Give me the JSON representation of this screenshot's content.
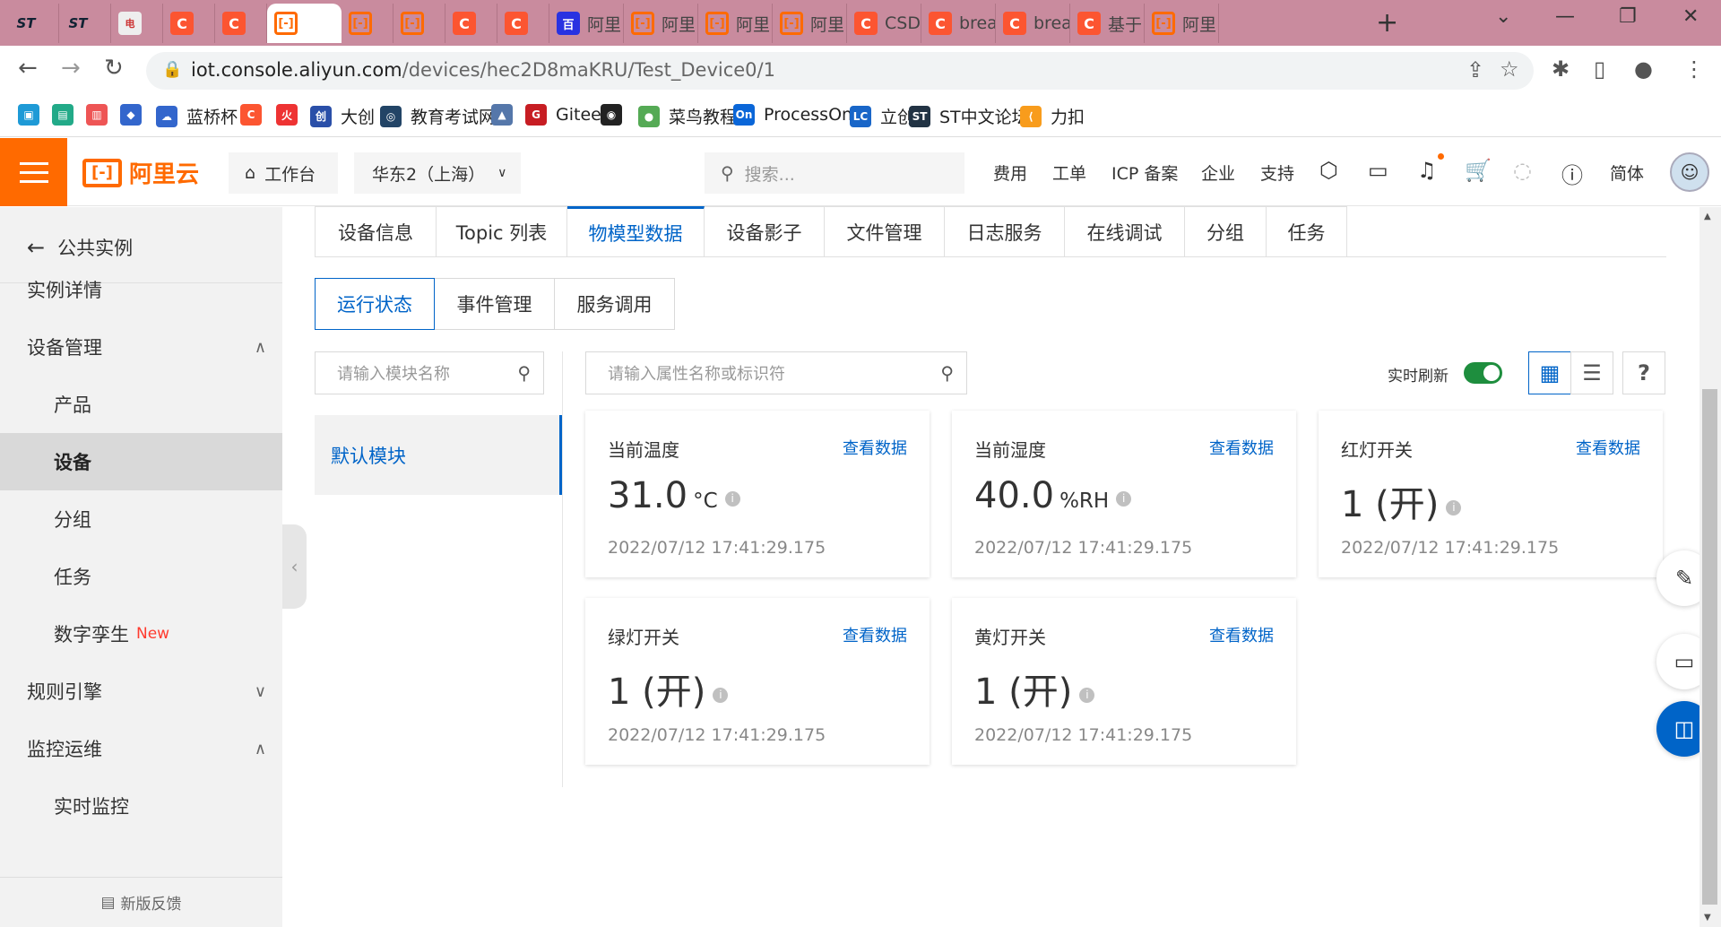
{
  "browser": {
    "tabs": [
      {
        "icon": "st-icon",
        "title": ""
      },
      {
        "icon": "st-icon",
        "title": ""
      },
      {
        "icon": "image-icon",
        "title": ""
      },
      {
        "icon": "csdn-icon",
        "title": ""
      },
      {
        "icon": "csdn-icon",
        "title": ""
      },
      {
        "icon": "aliyun-icon",
        "title": "",
        "active": true
      },
      {
        "icon": "aliyun-icon",
        "title": ""
      },
      {
        "icon": "aliyun-icon",
        "title": ""
      },
      {
        "icon": "csdn-icon",
        "title": ""
      },
      {
        "icon": "csdn-icon",
        "title": ""
      },
      {
        "icon": "baidu-icon",
        "title": "阿里"
      },
      {
        "icon": "aliyun-icon",
        "title": "阿里"
      },
      {
        "icon": "aliyun-icon",
        "title": "阿里"
      },
      {
        "icon": "aliyun-icon",
        "title": "阿里"
      },
      {
        "icon": "csdn-icon",
        "title": "CSDI"
      },
      {
        "icon": "csdn-icon",
        "title": "brea"
      },
      {
        "icon": "csdn-icon",
        "title": "brea"
      },
      {
        "icon": "csdn-icon",
        "title": "基于"
      },
      {
        "icon": "aliyun-icon",
        "title": "阿里"
      }
    ],
    "url_host": "iot.console.aliyun.com",
    "url_path": "/devices/hec2D8maKRU/Test_Device0/1",
    "bookmarks": [
      {
        "icon": "lock-icon",
        "label": ""
      },
      {
        "icon": "book-icon",
        "label": ""
      },
      {
        "icon": "chart-icon",
        "label": ""
      },
      {
        "icon": "stack-icon",
        "label": ""
      },
      {
        "icon": "cloud-icon",
        "label": "蓝桥杯"
      },
      {
        "icon": "csdn-icon",
        "label": ""
      },
      {
        "icon": "fire-icon",
        "label": ""
      },
      {
        "icon": "dachuang-icon",
        "label": "大创"
      },
      {
        "icon": "globe-icon",
        "label": "教育考试网"
      },
      {
        "icon": "mountain-icon",
        "label": ""
      },
      {
        "icon": "gitee-icon",
        "label": "Gitee"
      },
      {
        "icon": "github-icon",
        "label": ""
      },
      {
        "icon": "runoob-icon",
        "label": "菜鸟教程"
      },
      {
        "icon": "processon-icon",
        "label": "ProcessOn"
      },
      {
        "icon": "lc-icon",
        "label": "立创"
      },
      {
        "icon": "st-icon",
        "label": "ST中文论坛"
      },
      {
        "icon": "leetcode-icon",
        "label": "力扣"
      }
    ]
  },
  "topnav": {
    "brand": "阿里云",
    "workbench": "工作台",
    "region": "华东2（上海）",
    "search_placeholder": "搜索...",
    "links": [
      "费用",
      "工单",
      "ICP 备案",
      "企业",
      "支持"
    ],
    "language": "简体"
  },
  "sidebar": {
    "back_label": "公共实例",
    "items": [
      {
        "label": "实例详情",
        "level": 1
      },
      {
        "label": "设备管理",
        "level": 1,
        "expanded": true
      },
      {
        "label": "产品",
        "level": 2
      },
      {
        "label": "设备",
        "level": 2,
        "selected": true
      },
      {
        "label": "分组",
        "level": 2
      },
      {
        "label": "任务",
        "level": 2
      },
      {
        "label": "数字孪生",
        "level": 2,
        "badge": "New"
      },
      {
        "label": "规则引擎",
        "level": 1,
        "expanded": false
      },
      {
        "label": "监控运维",
        "level": 1,
        "expanded": true
      },
      {
        "label": "实时监控",
        "level": 2
      }
    ],
    "feedback": "新版反馈"
  },
  "main": {
    "tabs": [
      "设备信息",
      "Topic 列表",
      "物模型数据",
      "设备影子",
      "文件管理",
      "日志服务",
      "在线调试",
      "分组",
      "任务"
    ],
    "active_tab": "物模型数据",
    "subtabs": [
      "运行状态",
      "事件管理",
      "服务调用"
    ],
    "active_subtab": "运行状态",
    "module_search_placeholder": "请输入模块名称",
    "module": "默认模块",
    "prop_search_placeholder": "请输入属性名称或标识符",
    "realtime_label": "实时刷新",
    "realtime_on": true,
    "cards": [
      {
        "name": "当前温度",
        "link": "查看数据",
        "value": "31.0",
        "unit": "°C",
        "time": "2022/07/12 17:41:29.175"
      },
      {
        "name": "当前湿度",
        "link": "查看数据",
        "value": "40.0",
        "unit": "%RH",
        "time": "2022/07/12 17:41:29.175"
      },
      {
        "name": "红灯开关",
        "link": "查看数据",
        "value": "1 (开)",
        "unit": "",
        "time": "2022/07/12 17:41:29.175"
      },
      {
        "name": "绿灯开关",
        "link": "查看数据",
        "value": "1 (开)",
        "unit": "",
        "time": "2022/07/12 17:41:29.175"
      },
      {
        "name": "黄灯开关",
        "link": "查看数据",
        "value": "1 (开)",
        "unit": "",
        "time": "2022/07/12 17:41:29.175"
      }
    ]
  },
  "colors": {
    "accent": "#0064c8",
    "brand": "#ff6a00",
    "toggle_on": "#1e8e3e"
  }
}
